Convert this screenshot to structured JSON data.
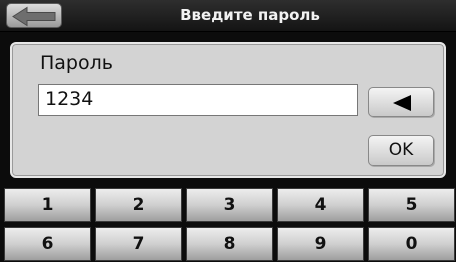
{
  "dialog": {
    "title": "Введите пароль",
    "field_label": "Пароль",
    "password_value": "1234",
    "ok_label": "OK"
  },
  "keypad": {
    "row1": [
      "1",
      "2",
      "3",
      "4",
      "5"
    ],
    "row2": [
      "6",
      "7",
      "8",
      "9",
      "0"
    ]
  },
  "icons": {
    "back": "back-arrow-icon",
    "backspace": "backspace-triangle-icon"
  }
}
